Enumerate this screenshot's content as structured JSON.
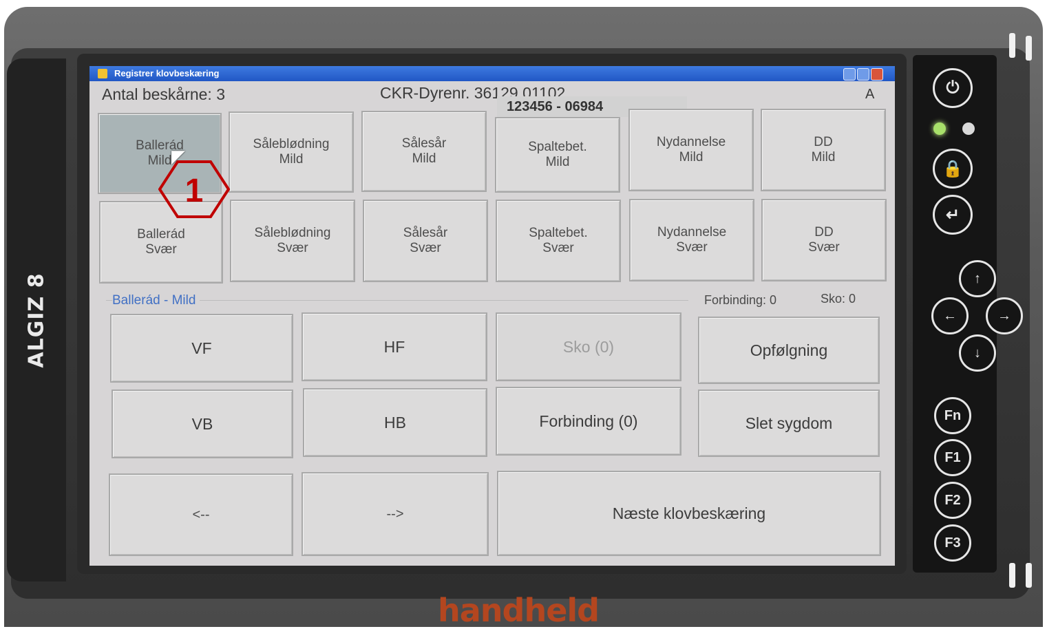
{
  "device": {
    "brand_side": "ALGIZ 8",
    "brand_bottom": "handheld"
  },
  "window": {
    "title": "Registrer klovbeskæring"
  },
  "header": {
    "count_label": "Antal beskårne: 3",
    "animal_label": "CKR-Dyrenr. 36129 01102",
    "animal_overlay": "123456 - 06984",
    "mode_letter": "A"
  },
  "diseases": [
    {
      "name": "Ballerád",
      "severity": "Mild"
    },
    {
      "name": "Sålеblødning",
      "severity": "Mild"
    },
    {
      "name": "Sålesår",
      "severity": "Mild"
    },
    {
      "name": "Spaltebet.",
      "severity": "Mild"
    },
    {
      "name": "Nydannelse",
      "severity": "Mild"
    },
    {
      "name": "DD",
      "severity": "Mild"
    },
    {
      "name": "Ballerád",
      "severity": "Svær"
    },
    {
      "name": "Sålеblødning",
      "severity": "Svær"
    },
    {
      "name": "Sålesår",
      "severity": "Svær"
    },
    {
      "name": "Spaltebet.",
      "severity": "Svær"
    },
    {
      "name": "Nydannelse",
      "severity": "Svær"
    },
    {
      "name": "DD",
      "severity": "Svær"
    }
  ],
  "selection": {
    "group_label": "Ballerád - Mild",
    "forbinding_count": "Forbinding: 0",
    "sko_count": "Sko: 0"
  },
  "hoof_buttons": {
    "vf": "VF",
    "hf": "HF",
    "sko": "Sko (0)",
    "vb": "VB",
    "hb": "HB",
    "forbinding": "Forbinding (0)"
  },
  "actions": {
    "opfolgning": "Opfølgning",
    "slet": "Slet sygdom",
    "prev": "<--",
    "next": "-->",
    "next_trim": "Næste klovbeskæring"
  },
  "annotation": {
    "callout_number": "1"
  },
  "keys": {
    "fn": "Fn",
    "f1": "F1",
    "f2": "F2",
    "f3": "F3"
  },
  "colors": {
    "selected_button": "#a9b4b6",
    "group_label": "#4170c4",
    "callout": "#c00000",
    "brand": "#b4461f"
  }
}
